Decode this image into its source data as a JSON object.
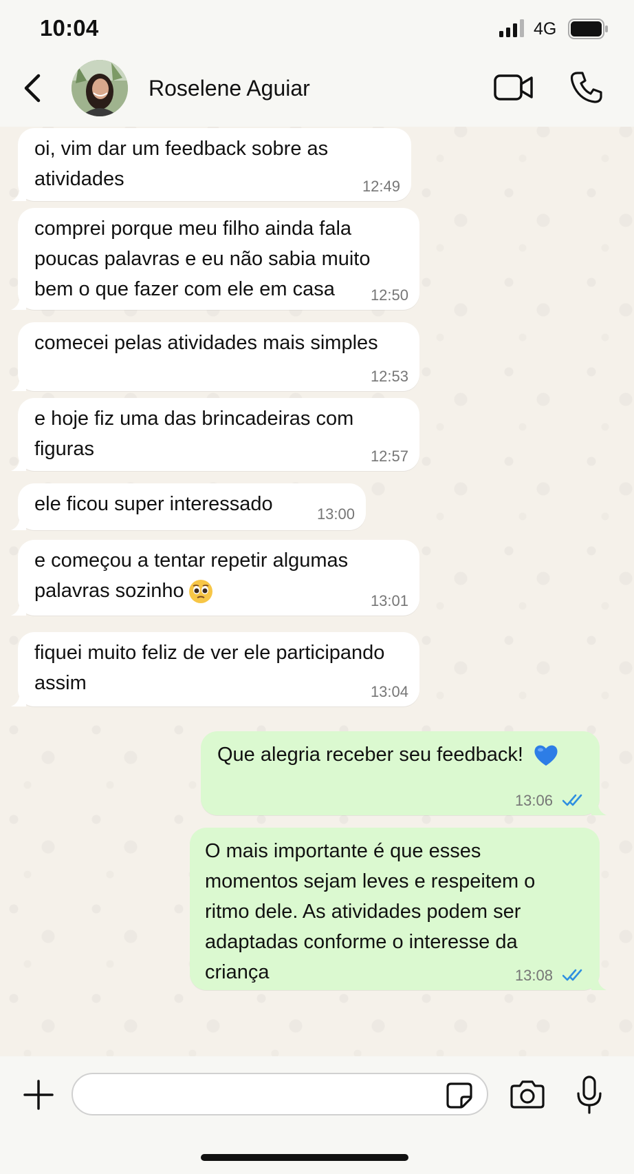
{
  "status_bar": {
    "time": "10:04",
    "network": "4G",
    "signal_icon": "signal-bars-icon",
    "battery_icon": "battery-full-icon"
  },
  "header": {
    "contact_name": "Roselene Aguiar",
    "back_icon": "chevron-left-icon",
    "video_icon": "video-camera-icon",
    "call_icon": "phone-icon"
  },
  "messages": [
    {
      "direction": "in",
      "text": "oi, vim dar um feedback sobre as\natividades",
      "time": "12:49"
    },
    {
      "direction": "in",
      "text": "comprei porque meu filho ainda fala\npoucas palavras e eu não sabia muito\nbem o que fazer com ele em casa",
      "time": "12:50"
    },
    {
      "direction": "in",
      "text": "comecei pelas atividades mais simples",
      "time": "12:53"
    },
    {
      "direction": "in",
      "text": "e hoje fiz uma das brincadeiras com\nfiguras",
      "time": "12:57"
    },
    {
      "direction": "in",
      "text": "ele ficou super interessado",
      "time": "13:00"
    },
    {
      "direction": "in",
      "text": "e começou a tentar repetir algumas\npalavras sozinho",
      "emoji": "pleading-face-emoji",
      "time": "13:01"
    },
    {
      "direction": "in",
      "text": "fiquei muito feliz de ver ele participando\nassim",
      "time": "13:04"
    },
    {
      "direction": "out",
      "text": "Que alegria receber seu feedback!",
      "emoji": "blue-heart-emoji",
      "time": "13:06",
      "status": "read"
    },
    {
      "direction": "out",
      "text": "O mais importante é que esses\nmomentos sejam leves e respeitem o\nritmo dele. As atividades podem ser\nadaptadas conforme o interesse da\ncriança",
      "time": "13:08",
      "status": "read"
    }
  ],
  "composer": {
    "input_value": "",
    "plus_icon": "plus-icon",
    "sticker_icon": "sticker-icon",
    "camera_icon": "camera-icon",
    "mic_icon": "microphone-icon"
  },
  "colors": {
    "incoming_bubble": "#ffffff",
    "outgoing_bubble": "#dbf9d0",
    "read_tick": "#2f8fe0",
    "chat_background": "#f5f1ea",
    "header_background": "#f7f7f4"
  }
}
